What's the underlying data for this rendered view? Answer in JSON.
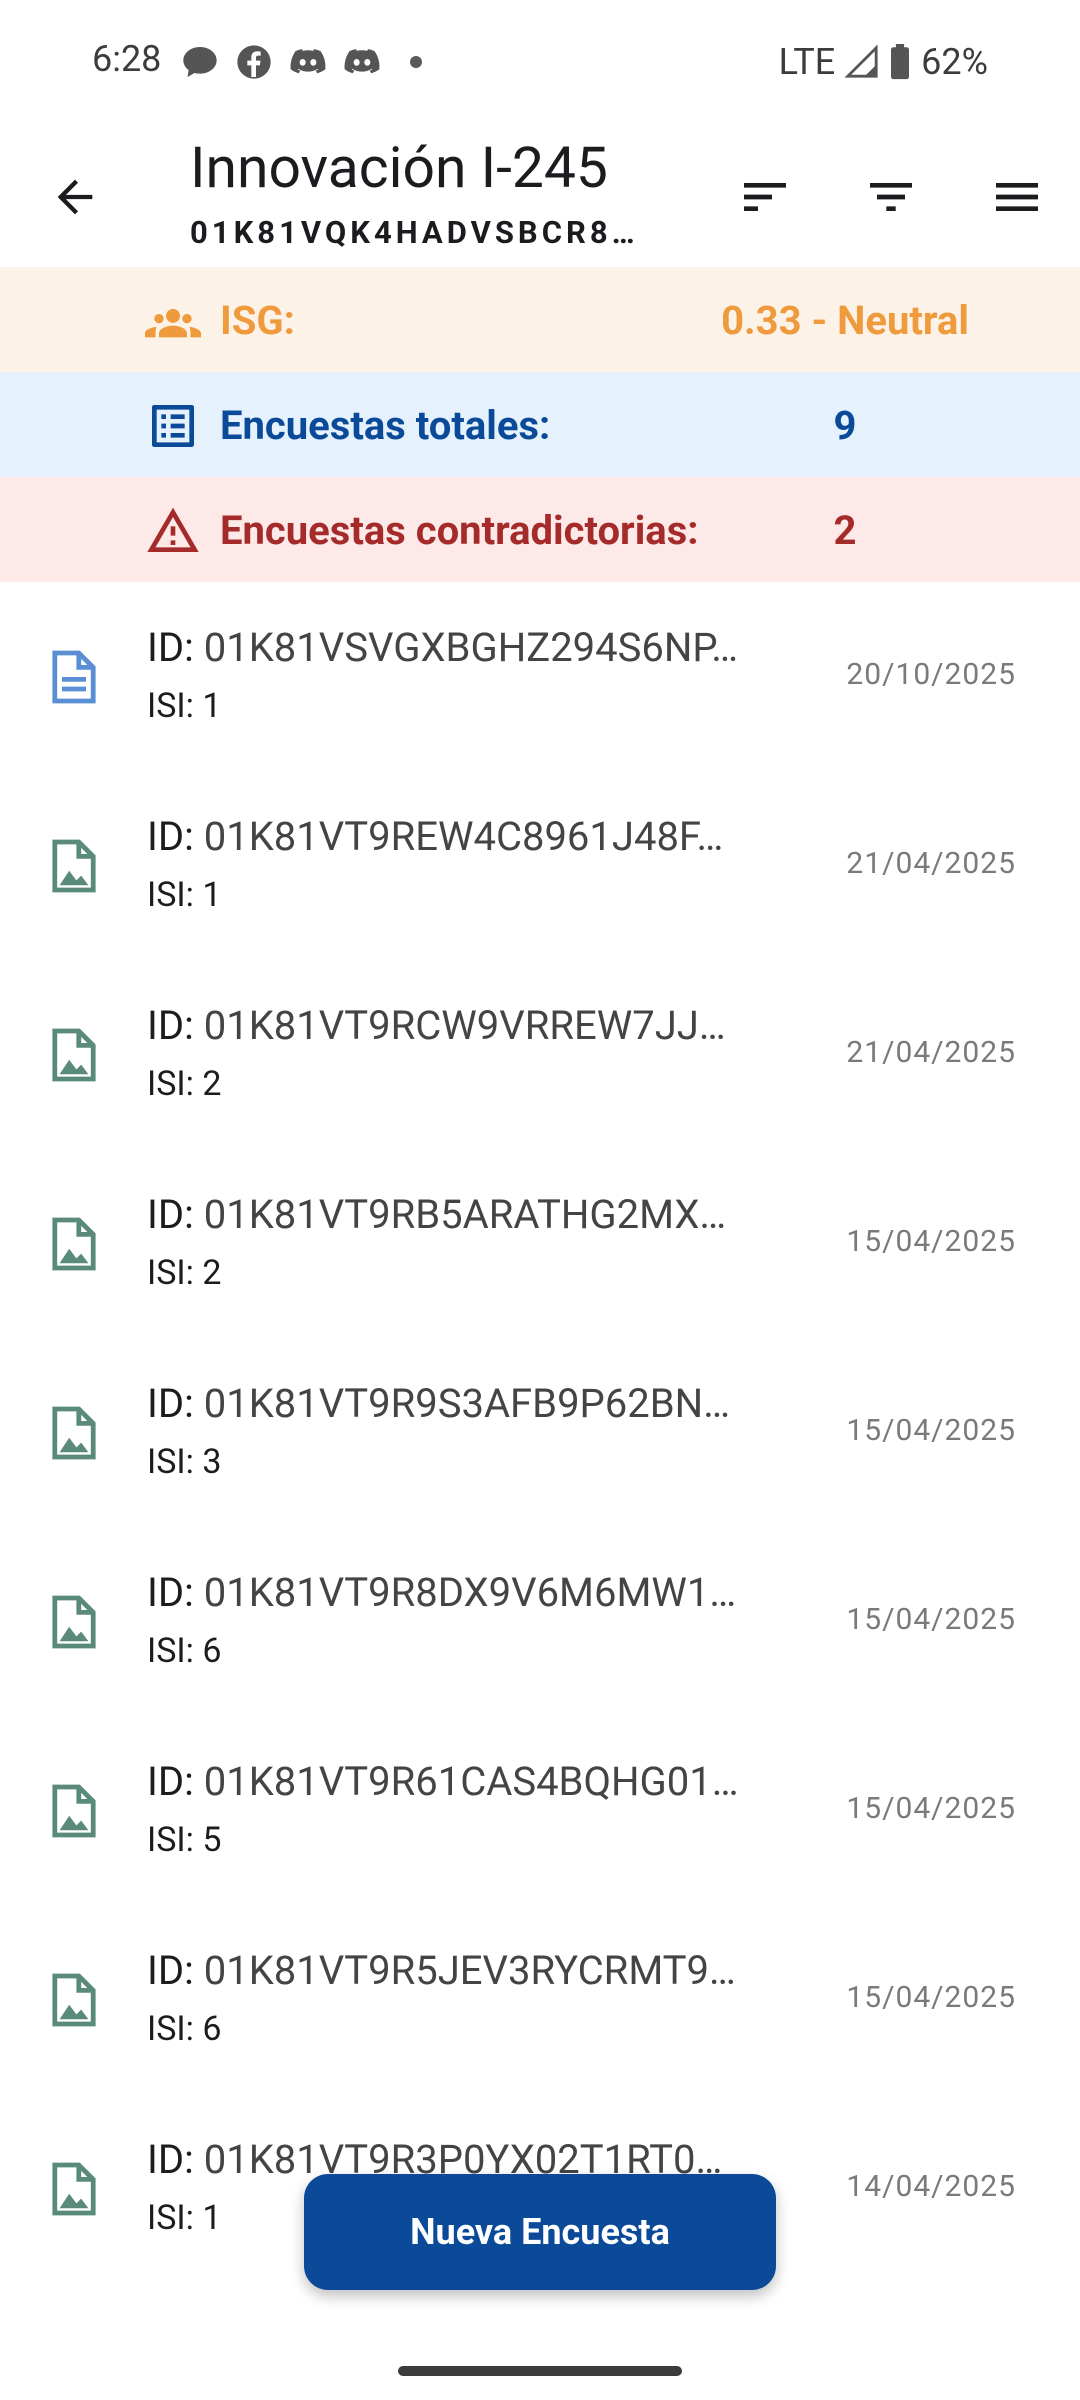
{
  "status_bar": {
    "time": "6:28",
    "network": "LTE",
    "battery": "62%",
    "notification_icons": [
      "chat-bubble-icon",
      "facebook-icon",
      "discord-icon",
      "discord-icon"
    ]
  },
  "app_bar": {
    "title": "Innovación I-245",
    "subtitle": "01K81VQK4HADVSBCR8…",
    "actions": [
      "sort-icon",
      "filter-icon",
      "menu-icon"
    ]
  },
  "summary": {
    "isg": {
      "label": "ISG:",
      "value": "0.33 - Neutral",
      "color": "#ef9a3c"
    },
    "total": {
      "label": "Encuestas totales:",
      "value": "9",
      "color": "#0b4a99"
    },
    "contradictory": {
      "label": "Encuestas contradictorias:",
      "value": "2",
      "color": "#a52a2a"
    }
  },
  "surveys": [
    {
      "id_label": "ID:",
      "id": "01K81VSVGXBGHZ294S6NP…",
      "isi": "ISI: 1",
      "date": "20/10/2025",
      "icon": "text-document-icon",
      "icon_color": "#5b8fd4"
    },
    {
      "id_label": "ID:",
      "id": "01K81VT9REW4C8961J48F…",
      "isi": "ISI: 1",
      "date": "21/04/2025",
      "icon": "image-document-icon",
      "icon_color": "#5a8a7a"
    },
    {
      "id_label": "ID:",
      "id": "01K81VT9RCW9VRREW7JJ…",
      "isi": "ISI: 2",
      "date": "21/04/2025",
      "icon": "image-document-icon",
      "icon_color": "#5a8a7a"
    },
    {
      "id_label": "ID:",
      "id": "01K81VT9RB5ARATHG2MX…",
      "isi": "ISI: 2",
      "date": "15/04/2025",
      "icon": "image-document-icon",
      "icon_color": "#5a8a7a"
    },
    {
      "id_label": "ID:",
      "id": "01K81VT9R9S3AFB9P62BN…",
      "isi": "ISI: 3",
      "date": "15/04/2025",
      "icon": "image-document-icon",
      "icon_color": "#5a8a7a"
    },
    {
      "id_label": "ID:",
      "id": "01K81VT9R8DX9V6M6MW1…",
      "isi": "ISI: 6",
      "date": "15/04/2025",
      "icon": "image-document-icon",
      "icon_color": "#5a8a7a"
    },
    {
      "id_label": "ID:",
      "id": "01K81VT9R61CAS4BQHG01…",
      "isi": "ISI: 5",
      "date": "15/04/2025",
      "icon": "image-document-icon",
      "icon_color": "#5a8a7a"
    },
    {
      "id_label": "ID:",
      "id": "01K81VT9R5JEV3RYCRMT9…",
      "isi": "ISI: 6",
      "date": "15/04/2025",
      "icon": "image-document-icon",
      "icon_color": "#5a8a7a"
    },
    {
      "id_label": "ID:",
      "id": "01K81VT9R3P0YX02T1RT0…",
      "isi": "ISI: 1",
      "date": "14/04/2025",
      "icon": "image-document-icon",
      "icon_color": "#5a8a7a"
    }
  ],
  "fab": {
    "label": "Nueva Encuesta",
    "color": "#0b4a99"
  }
}
